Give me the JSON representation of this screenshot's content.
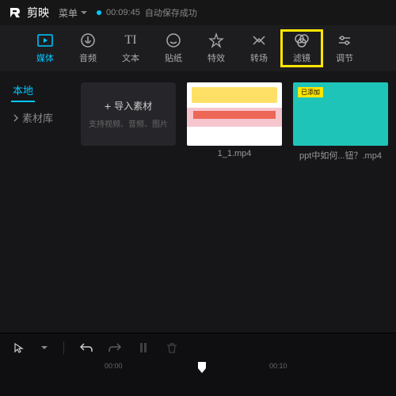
{
  "titlebar": {
    "app_name": "剪映",
    "menu_label": "菜单",
    "autosave_time": "00:09:45",
    "autosave_label": "自动保存成功"
  },
  "toolbar": {
    "items": [
      {
        "label": "媒体",
        "icon": "media"
      },
      {
        "label": "音频",
        "icon": "audio"
      },
      {
        "label": "文本",
        "icon": "text"
      },
      {
        "label": "贴纸",
        "icon": "sticker"
      },
      {
        "label": "特效",
        "icon": "effect"
      },
      {
        "label": "转场",
        "icon": "transition"
      },
      {
        "label": "滤镜",
        "icon": "filter"
      },
      {
        "label": "调节",
        "icon": "adjust"
      }
    ]
  },
  "sidebar": {
    "items": [
      {
        "label": "本地"
      },
      {
        "label": "素材库"
      }
    ]
  },
  "import": {
    "label": "导入素材",
    "sub": "支持视频、音频、图片"
  },
  "media": {
    "items": [
      {
        "name": "1_1.mp4"
      },
      {
        "name": "ppt中如何...钮？.mp4",
        "badge": "已添加"
      }
    ]
  },
  "timeline": {
    "marks": [
      "00:00",
      "00:10"
    ]
  }
}
